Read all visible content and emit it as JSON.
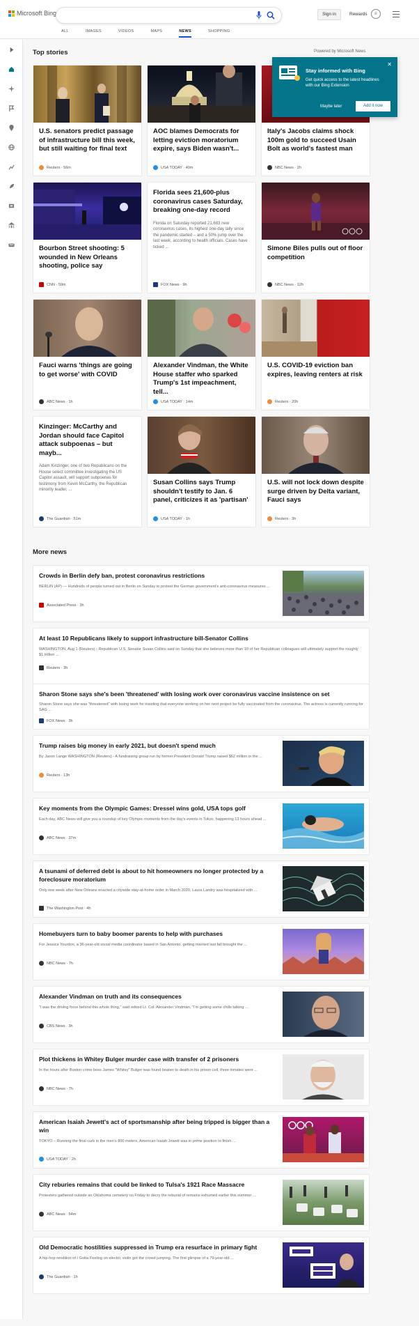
{
  "header": {
    "logo_text": "Microsoft Bing",
    "signin": "Sign in",
    "rewards": "Rewards",
    "search_placeholder": ""
  },
  "tabs": [
    "ALL",
    "IMAGES",
    "VIDEOS",
    "MAPS",
    "NEWS",
    "SHOPPING"
  ],
  "active_tab": "NEWS",
  "top_stories": {
    "title": "Top stories",
    "powered": "Powered by Microsoft News",
    "cards": [
      {
        "title": "U.S. senators predict passage of infrastructure bill this week, but still waiting for final text",
        "snippet": "",
        "source": "Reuters",
        "time": "56m",
        "icon_color": "#f08c3a"
      },
      {
        "title": "AOC blames Democrats for letting eviction moratorium expire, says Biden wasn't...",
        "snippet": "",
        "source": "USA TODAY",
        "time": "40m",
        "icon_color": "#1e90e6"
      },
      {
        "title": "Italy's Jacobs claims shock 100m gold to succeed Usain Bolt as world's fastest man",
        "snippet": "",
        "source": "NBC News",
        "time": "2h",
        "icon_color": "#333333"
      },
      {
        "title": "Bourbon Street shooting: 5 wounded in New Orleans shooting, police say",
        "snippet": "",
        "source": "CNN",
        "time": "59m",
        "icon_color": "#cc0000"
      },
      {
        "title": "Florida sees 21,600-plus coronavirus cases Saturday, breaking one-day record",
        "snippet": "Florida on Saturday reported 21,683 new coronavirus cases, its highest one-day tally since the pandemic started – and a 50% jump over the last week, according to health officials.  Cases have ticked ...",
        "source": "FOX News",
        "time": "9h",
        "icon_color": "#1a3a7a"
      },
      {
        "title": "Simone Biles pulls out of floor competition",
        "snippet": "",
        "source": "NBC News",
        "time": "12h",
        "icon_color": "#333333"
      },
      {
        "title": "Fauci warns 'things are going to get worse' with COVID",
        "snippet": "",
        "source": "ABC News",
        "time": "1h",
        "icon_color": "#333333"
      },
      {
        "title": "Alexander Vindman, the White House staffer who sparked Trump's 1st impeachment, tell...",
        "snippet": "",
        "source": "USA TODAY",
        "time": "14m",
        "icon_color": "#1e90e6"
      },
      {
        "title": "U.S. COVID-19 eviction ban expires, leaving renters at risk",
        "snippet": "",
        "source": "Reuters",
        "time": "20h",
        "icon_color": "#f08c3a"
      },
      {
        "title": "Kinzinger: McCarthy and Jordan should face Capitol attack subpoenas – but mayb...",
        "snippet": "Adam Kinzinger, one of two Republicans on the House select committee investigating the US Capitol assault, will support subpoenas for testimony from Kevin McCarthy, the Republican minority leader, ...",
        "source": "The Guardian",
        "time": "51m",
        "icon_color": "#1a3a7a"
      },
      {
        "title": "Susan Collins says Trump shouldn't testify to Jan. 6 panel, criticizes it as 'partisan'",
        "snippet": "",
        "source": "USA TODAY",
        "time": "1h",
        "icon_color": "#1e90e6"
      },
      {
        "title": "U.S. will not lock down despite surge driven by Delta variant, Fauci says",
        "snippet": "",
        "source": "Reuters",
        "time": "3h",
        "icon_color": "#f08c3a"
      }
    ]
  },
  "popup": {
    "title": "Stay informed with Bing",
    "text": "Get quick access to the latest headlines with our Bing Extension",
    "later": "Maybe later",
    "add": "Add it now"
  },
  "more_news": {
    "title": "More news",
    "items": [
      {
        "title": "Crowds in Berlin defy ban, protest coronavirus restrictions",
        "snippet": "BERLIN (AP) — Hundreds of people turned out in Berlin on Sunday to protest the German government's anti-coronavirus measures ...",
        "source": "Associated Press",
        "time": "3h",
        "icon_color": "#cc0000"
      },
      {
        "title": "At least 10 Republicans likely to support infrastructure bill-Senator Collins",
        "snippet": "WASHINGTON, Aug 1 (Reuters) - Republican U.S. Senator Susan Collins said on Sunday that she believes more than 10 of her Republican colleagues will ultimately support the roughly $1 trillion ...",
        "source": "Reuters",
        "time": "3h",
        "icon_color": "#333333"
      },
      {
        "title": "Sharon Stone says she's been 'threatened' with losing work over coronavirus vaccine insistence on set",
        "snippet": "Sharon Stone says she was \"threatened\" with losing work for insisting that everyone working on her next project be fully vaccinated from the coronavirus.  The actress is currently running for SAG ...",
        "source": "FOX News",
        "time": "3h",
        "icon_color": "#1a3a7a"
      },
      {
        "title": "Trump raises big money in early 2021, but doesn't spend much",
        "snippet": "By Jason Lange WASHINGTON (Reuters) - A fundraising group run by former President Donald Trump raised $62 million in the ...",
        "source": "Reuters",
        "time": "13h",
        "icon_color": "#f08c3a"
      },
      {
        "title": "Key moments from the Olympic Games: Dressel wins gold, USA tops golf",
        "snippet": "Each day, ABC News will give you a roundup of key Olympic moments from the day's events in Tokyo, happening 13 hours ahead ...",
        "source": "ABC News",
        "time": "37m",
        "icon_color": "#333333"
      },
      {
        "title": "A tsunami of deferred debt is about to hit homeowners no longer protected by a foreclosure moratorium",
        "snippet": "Only one week after New Orleans enacted a citywide stay-at-home order in March 2020, Laura Landry was hospitalized with ...",
        "source": "The Washington Post",
        "time": "4h",
        "icon_color": "#333333"
      },
      {
        "title": "Homebuyers turn to baby boomer parents to help with purchases",
        "snippet": "For Jessica Yourdon, a 36-year-old social media coordinator based in San Antonio, getting married last fall brought the ...",
        "source": "NBC News",
        "time": "7h",
        "icon_color": "#333333"
      },
      {
        "title": "Alexander Vindman on truth and its consequences",
        "snippet": "\"I was the driving force behind this whole thing,\" said retired Lt. Col. Alexander Vindman. \"I'm getting some chills talking ...",
        "source": "CBS News",
        "time": "3h",
        "icon_color": "#333333"
      },
      {
        "title": "Plot thickens in Whitey Bulger murder case with transfer of 2 prisoners",
        "snippet": "In the hours after Boston crime boss James \"Whitey\" Bulger was found beaten to death in his prison cell, three inmates were ...",
        "source": "NBC News",
        "time": "7h",
        "icon_color": "#333333"
      },
      {
        "title": "American Isaiah Jewett's act of sportsmanship after being tripped is bigger than a win",
        "snippet": "TOKYO – Running the final curb in the men's 800 meters, American Isaiah Jewett was in prime position to finish ...",
        "source": "USA TODAY",
        "time": "2h",
        "icon_color": "#1e90e6"
      },
      {
        "title": "City reburies remains that could be linked to Tulsa's 1921 Race Massacre",
        "snippet": "Protesters gathered outside an Oklahoma cemetery on Friday to decry the reburial of remains exhumed earlier this summer ...",
        "source": "ABC News",
        "time": "54m",
        "icon_color": "#333333"
      },
      {
        "title": "Old Democratic hostilities suppressed in Trump era resurface in primary fight",
        "snippet": "A hip-hop rendition of I Gotta Feeling on electric violin got the crowd jumping. The first glimpse of a 79-year-old ...",
        "source": "The Guardian",
        "time": "1h",
        "icon_color": "#1a3a7a"
      }
    ]
  },
  "footer": {
    "left": "",
    "right": ""
  }
}
